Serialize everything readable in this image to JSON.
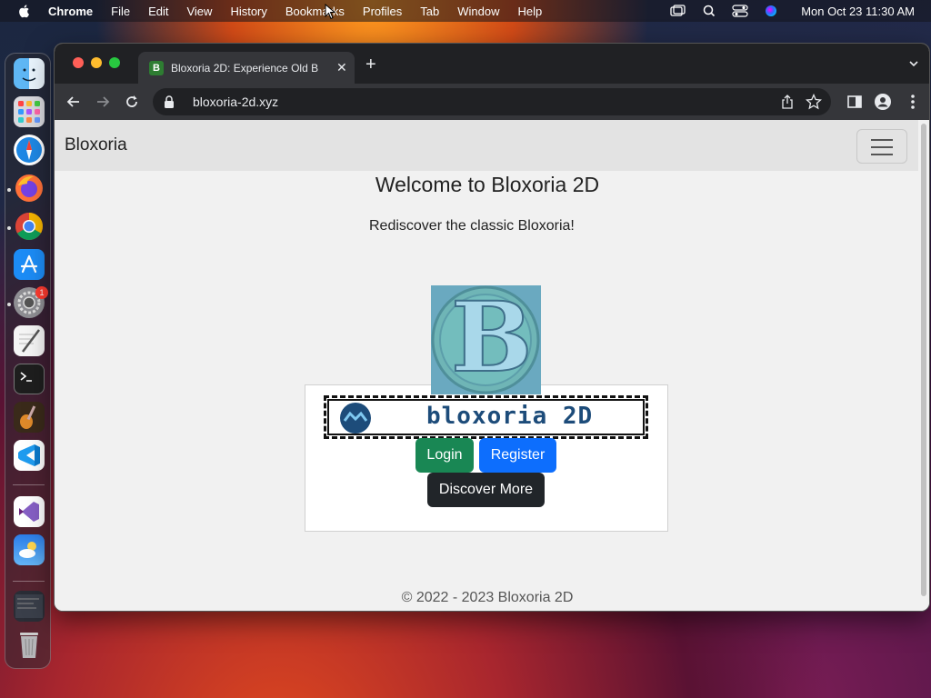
{
  "menubar": {
    "app": "Chrome",
    "items": [
      "File",
      "Edit",
      "View",
      "History",
      "Bookmarks",
      "Profiles",
      "Tab",
      "Window",
      "Help"
    ],
    "clock": "Mon Oct 23  11:30 AM"
  },
  "dock": {
    "apps": [
      "finder-icon",
      "launchpad-icon",
      "safari-icon",
      "firefox-icon",
      "chrome-icon",
      "app-store-icon",
      "system-settings-icon",
      "textedit-icon",
      "terminal-icon",
      "garageband-icon",
      "vscode-icon",
      "visual-studio-icon",
      "weather-icon",
      "screenshot-thumbnail-icon",
      "trash-icon"
    ],
    "settings_badge": "1"
  },
  "browser": {
    "tab_title": "Bloxoria 2D: Experience Old B",
    "tab_favicon": "B",
    "url": "bloxoria-2d.xyz"
  },
  "page": {
    "brand": "Bloxoria",
    "heading": "Welcome to Bloxoria 2D",
    "lead": "Rediscover the classic Bloxoria!",
    "logo_letter": "B",
    "banner_text": "bloxoria 2D",
    "buttons": {
      "login": "Login",
      "register": "Register",
      "discover": "Discover More"
    },
    "footer": "© 2022 - 2023 Bloxoria 2D"
  },
  "colors": {
    "login": "#198754",
    "register": "#0d6efd",
    "discover": "#212529",
    "navbar": "#e3e3e3"
  }
}
